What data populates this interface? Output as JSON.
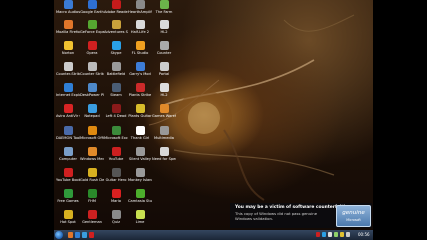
{
  "desktop": {
    "icons": [
      {
        "label": "Macro Audiosurf",
        "icon": "app-icon",
        "color": "#3a7bd5"
      },
      {
        "label": "Google Earth",
        "icon": "globe-icon",
        "color": "#2e6fd3"
      },
      {
        "label": "Adobe Reader 9",
        "icon": "pdf-icon",
        "color": "#c41b1b"
      },
      {
        "label": "HearthAmplify Freeloader",
        "icon": "app-icon",
        "color": "#8a8a8a"
      },
      {
        "label": "The Farm",
        "icon": "game-icon",
        "color": "#6bb34a"
      },
      {
        "label": "Mozilla Firefox",
        "icon": "firefox-icon",
        "color": "#e0762a"
      },
      {
        "label": "GeForce Experience",
        "icon": "app-icon",
        "color": "#55a630"
      },
      {
        "label": "Adventures Spring",
        "icon": "game-icon",
        "color": "#c9a13b"
      },
      {
        "label": "Half-Life 2",
        "icon": "halflife-icon",
        "color": "#d9d9d9"
      },
      {
        "label": "HL2",
        "icon": "halflife-icon",
        "color": "#d9d9d9"
      },
      {
        "label": "Norton",
        "icon": "shield-icon",
        "color": "#f2c230"
      },
      {
        "label": "Opera",
        "icon": "opera-icon",
        "color": "#d12020"
      },
      {
        "label": "Skype",
        "icon": "skype-icon",
        "color": "#2aa0e6"
      },
      {
        "label": "FL Studio",
        "icon": "fruit-icon",
        "color": "#f0a020"
      },
      {
        "label": "Counter",
        "icon": "game-icon",
        "color": "#aaaaaa"
      },
      {
        "label": "Counter-Strike",
        "icon": "game-icon",
        "color": "#cccccc"
      },
      {
        "label": "Counter Strike",
        "icon": "game-icon",
        "color": "#bbbbbb"
      },
      {
        "label": "Battlefield",
        "icon": "game-icon",
        "color": "#9a9a9a"
      },
      {
        "label": "Garry's Mod",
        "icon": "game-icon",
        "color": "#3d7dd8"
      },
      {
        "label": "Portal",
        "icon": "app-icon",
        "color": "#cccccc"
      },
      {
        "label": "Internet Explorer",
        "icon": "ie-icon",
        "color": "#2f7fd6"
      },
      {
        "label": "DeskPower Plus",
        "icon": "app-icon",
        "color": "#4d88c9"
      },
      {
        "label": "Steam",
        "icon": "steam-icon",
        "color": "#4a5d75"
      },
      {
        "label": "Plants Strike",
        "icon": "game-icon",
        "color": "#cc2a2a"
      },
      {
        "label": "HL2",
        "icon": "app-icon",
        "color": "#dddddd"
      },
      {
        "label": "Avira AntiVir Control Center",
        "icon": "umbrella-icon",
        "color": "#d82424"
      },
      {
        "label": "Notepad",
        "icon": "notepad-icon",
        "color": "#3a9de0"
      },
      {
        "label": "Left 4 Dead",
        "icon": "game-icon",
        "color": "#8a1a1a"
      },
      {
        "label": "Plants Guitar",
        "icon": "game-icon",
        "color": "#d8bc2a"
      },
      {
        "label": "Games Warehouse",
        "icon": "app-icon",
        "color": "#e08a2a"
      },
      {
        "label": "DAEMON Tools Lite",
        "icon": "daemon-icon",
        "color": "#4a6aa8"
      },
      {
        "label": "Microsoft Office",
        "icon": "office-icon",
        "color": "#e08a10"
      },
      {
        "label": "Microsoft Excel",
        "icon": "excel-icon",
        "color": "#3b8a3b"
      },
      {
        "label": "Thank Girl",
        "icon": "app-icon",
        "color": "#ffffff"
      },
      {
        "label": "Multimedia",
        "icon": "app-icon",
        "color": "#999999"
      },
      {
        "label": "Computer",
        "icon": "computer-icon",
        "color": "#7a9ec8"
      },
      {
        "label": "Windows Media",
        "icon": "app-icon",
        "color": "#e08a2a"
      },
      {
        "label": "YouTube",
        "icon": "app-icon",
        "color": "#cc2020"
      },
      {
        "label": "Silent Valley",
        "icon": "game-icon",
        "color": "#999999"
      },
      {
        "label": "Need for Speed",
        "icon": "game-icon",
        "color": "#d8d8d8"
      },
      {
        "label": "YouTube Book",
        "icon": "app-icon",
        "color": "#d02020"
      },
      {
        "label": "Gold Rush Deluxe",
        "icon": "game-icon",
        "color": "#d8b020"
      },
      {
        "label": "Guitar Hero",
        "icon": "game-icon",
        "color": "#555555"
      },
      {
        "label": "Monkey Island",
        "icon": "game-icon",
        "color": "#999999"
      },
      {
        "label": "Free Games",
        "icon": "app-icon",
        "color": "#2f9a3a"
      },
      {
        "label": "FHM",
        "icon": "app-icon",
        "color": "#2a8a2a"
      },
      {
        "label": "Mario",
        "icon": "game-icon",
        "color": "#d82020"
      },
      {
        "label": "Camtasia Studio 5",
        "icon": "camtasia-icon",
        "color": "#4cae2c"
      },
      {
        "label": "Hot Spot",
        "icon": "app-icon",
        "color": "#d8b020"
      },
      {
        "label": "Gentleman",
        "icon": "app-icon",
        "color": "#cc2020"
      },
      {
        "label": "Quiz",
        "icon": "app-icon",
        "color": "#8a8a8a"
      },
      {
        "label": "Lime",
        "icon": "app-icon",
        "color": "#c8e050"
      }
    ]
  },
  "genuine_notice": {
    "title": "You may be a victim of software counterfeiting",
    "body": "This copy of Windows did not pass genuine Windows validation.",
    "badge_main": "genuine",
    "badge_sub": "Microsoft"
  },
  "taskbar": {
    "clock": "00:56",
    "quick_launch_colors": [
      "#e0762a",
      "#2f7fd6",
      "#3a9de0",
      "#d12020"
    ],
    "tray_colors": [
      "#cc2020",
      "#2aa0e6",
      "#dddddd",
      "#8fd16a",
      "#e0c030",
      "#cccccc"
    ]
  }
}
